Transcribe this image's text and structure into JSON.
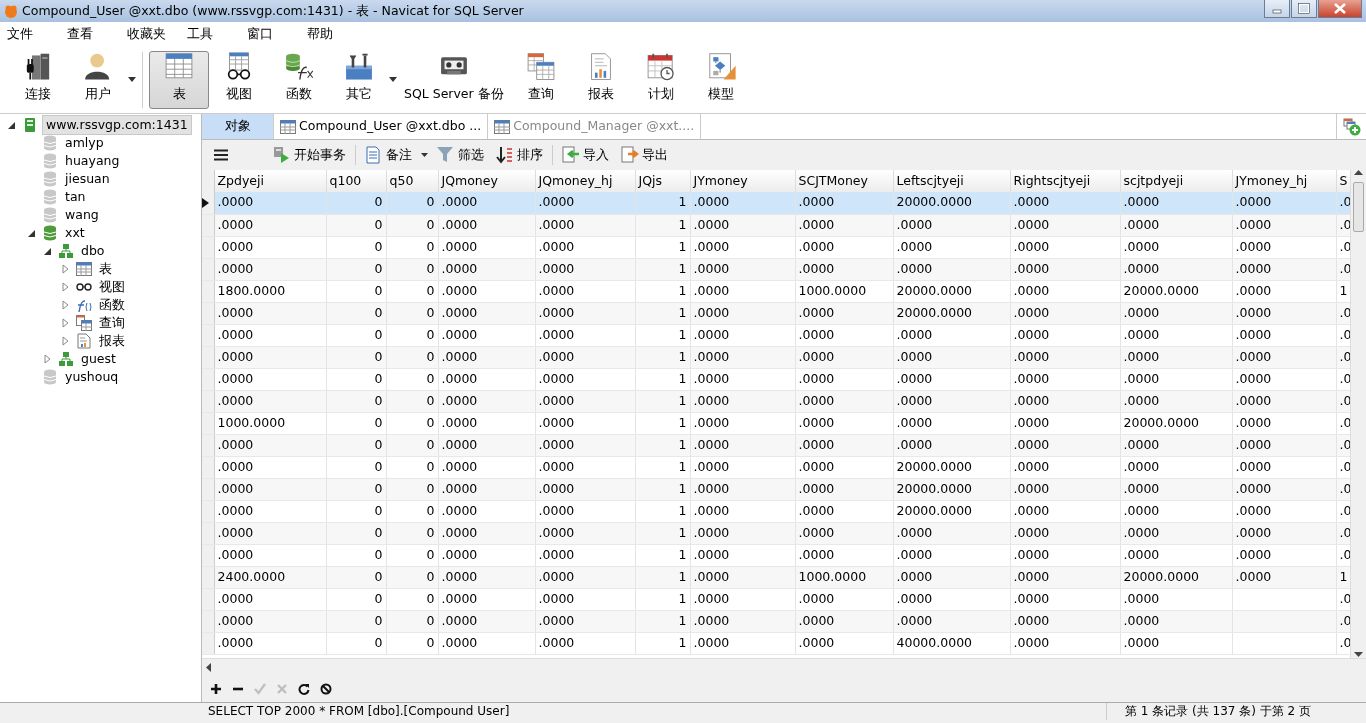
{
  "window": {
    "title": "Compound_User @xxt.dbo (www.rssvgp.com:1431) - 表 - Navicat for SQL Server"
  },
  "menu": [
    "文件",
    "查看",
    "收藏夹",
    "工具",
    "窗口",
    "帮助"
  ],
  "toolbar": [
    {
      "label": "连接",
      "selected": false,
      "dropdown": false
    },
    {
      "label": "用户",
      "selected": false,
      "dropdown": true
    },
    {
      "label": "表",
      "selected": true,
      "dropdown": false
    },
    {
      "label": "视图",
      "selected": false,
      "dropdown": false
    },
    {
      "label": "函数",
      "selected": false,
      "dropdown": false
    },
    {
      "label": "其它",
      "selected": false,
      "dropdown": true
    },
    {
      "label": "SQL Server 备份",
      "selected": false,
      "dropdown": false
    },
    {
      "label": "查询",
      "selected": false,
      "dropdown": false
    },
    {
      "label": "报表",
      "selected": false,
      "dropdown": false
    },
    {
      "label": "计划",
      "selected": false,
      "dropdown": false
    },
    {
      "label": "模型",
      "selected": false,
      "dropdown": false
    }
  ],
  "tree": [
    {
      "label": "www.rssvgp.com:1431",
      "kind": "server",
      "expanded": true,
      "selected": true,
      "children": [
        {
          "label": "amlyp",
          "kind": "database",
          "expanded": false,
          "selected": false
        },
        {
          "label": "huayang",
          "kind": "database",
          "expanded": false,
          "selected": false
        },
        {
          "label": "jiesuan",
          "kind": "database",
          "expanded": false,
          "selected": false
        },
        {
          "label": "tan",
          "kind": "database",
          "expanded": false,
          "selected": false
        },
        {
          "label": "wang",
          "kind": "database",
          "expanded": false,
          "selected": false
        },
        {
          "label": "xxt",
          "kind": "database",
          "expanded": true,
          "selected": false,
          "children": [
            {
              "label": "dbo",
              "kind": "schema",
              "expanded": true,
              "selected": false,
              "children": [
                {
                  "label": "表",
                  "kind": "table",
                  "expanded": false,
                  "selected": false
                },
                {
                  "label": "视图",
                  "kind": "view",
                  "expanded": false,
                  "selected": false
                },
                {
                  "label": "函数",
                  "kind": "function",
                  "expanded": false,
                  "selected": false
                },
                {
                  "label": "查询",
                  "kind": "query",
                  "expanded": false,
                  "selected": false
                },
                {
                  "label": "报表",
                  "kind": "report",
                  "expanded": false,
                  "selected": false
                }
              ]
            },
            {
              "label": "guest",
              "kind": "schema",
              "expanded": false,
              "selected": false
            }
          ]
        },
        {
          "label": "yushouq",
          "kind": "database",
          "expanded": false,
          "selected": false
        }
      ]
    }
  ],
  "tabs": [
    {
      "label": "对象",
      "kind": "objects",
      "selected": false
    },
    {
      "label": "Compound_User @xxt.dbo ...",
      "kind": "table",
      "selected": true
    },
    {
      "label": "Compound_Manager @xxt....",
      "kind": "table",
      "selected": false
    }
  ],
  "table_toolbar": [
    {
      "label": "开始事务",
      "dropdown": false
    },
    {
      "label": "备注",
      "dropdown": true
    },
    {
      "label": "筛选",
      "dropdown": false
    },
    {
      "label": "排序",
      "dropdown": false
    },
    {
      "label": "导入",
      "dropdown": false
    },
    {
      "label": "导出",
      "dropdown": false
    }
  ],
  "table": {
    "columns": [
      {
        "label": "Zpdyeji"
      },
      {
        "label": "q100"
      },
      {
        "label": "q50"
      },
      {
        "label": "JQmoney"
      },
      {
        "label": "JQmoney_hj"
      },
      {
        "label": "JQjs"
      },
      {
        "label": "JYmoney"
      },
      {
        "label": "SCJTMoney"
      },
      {
        "label": "Leftscjtyeji"
      },
      {
        "label": "Rightscjtyeji"
      },
      {
        "label": "scjtpdyeji"
      },
      {
        "label": "JYmoney_hj"
      },
      {
        "label": "S"
      }
    ],
    "rows": [
      {
        "selected": true,
        "cells": [
          ".0000",
          "0",
          "0",
          ".0000",
          ".0000",
          "1",
          ".0000",
          ".0000",
          "20000.0000",
          ".0000",
          ".0000",
          ".0000",
          ".0"
        ]
      },
      {
        "selected": false,
        "cells": [
          ".0000",
          "0",
          "0",
          ".0000",
          ".0000",
          "1",
          ".0000",
          ".0000",
          ".0000",
          ".0000",
          ".0000",
          ".0000",
          ".0"
        ]
      },
      {
        "selected": false,
        "cells": [
          ".0000",
          "0",
          "0",
          ".0000",
          ".0000",
          "1",
          ".0000",
          ".0000",
          ".0000",
          ".0000",
          ".0000",
          ".0000",
          ".0"
        ]
      },
      {
        "selected": false,
        "cells": [
          ".0000",
          "0",
          "0",
          ".0000",
          ".0000",
          "1",
          ".0000",
          ".0000",
          ".0000",
          ".0000",
          ".0000",
          ".0000",
          ".0"
        ]
      },
      {
        "selected": false,
        "cells": [
          "1800.0000",
          "0",
          "0",
          ".0000",
          ".0000",
          "1",
          ".0000",
          "1000.0000",
          "20000.0000",
          ".0000",
          "20000.0000",
          ".0000",
          "1"
        ]
      },
      {
        "selected": false,
        "cells": [
          ".0000",
          "0",
          "0",
          ".0000",
          ".0000",
          "1",
          ".0000",
          ".0000",
          "20000.0000",
          ".0000",
          ".0000",
          ".0000",
          ".0"
        ]
      },
      {
        "selected": false,
        "cells": [
          ".0000",
          "0",
          "0",
          ".0000",
          ".0000",
          "1",
          ".0000",
          ".0000",
          ".0000",
          ".0000",
          ".0000",
          ".0000",
          ".0"
        ]
      },
      {
        "selected": false,
        "cells": [
          ".0000",
          "0",
          "0",
          ".0000",
          ".0000",
          "1",
          ".0000",
          ".0000",
          ".0000",
          ".0000",
          ".0000",
          ".0000",
          ".0"
        ]
      },
      {
        "selected": false,
        "cells": [
          ".0000",
          "0",
          "0",
          ".0000",
          ".0000",
          "1",
          ".0000",
          ".0000",
          ".0000",
          ".0000",
          ".0000",
          ".0000",
          ".0"
        ]
      },
      {
        "selected": false,
        "cells": [
          ".0000",
          "0",
          "0",
          ".0000",
          ".0000",
          "1",
          ".0000",
          ".0000",
          ".0000",
          ".0000",
          ".0000",
          ".0000",
          ".0"
        ]
      },
      {
        "selected": false,
        "cells": [
          "1000.0000",
          "0",
          "0",
          ".0000",
          ".0000",
          "1",
          ".0000",
          ".0000",
          ".0000",
          ".0000",
          "20000.0000",
          ".0000",
          ".0"
        ]
      },
      {
        "selected": false,
        "cells": [
          ".0000",
          "0",
          "0",
          ".0000",
          ".0000",
          "1",
          ".0000",
          ".0000",
          ".0000",
          ".0000",
          ".0000",
          ".0000",
          ".0"
        ]
      },
      {
        "selected": false,
        "cells": [
          ".0000",
          "0",
          "0",
          ".0000",
          ".0000",
          "1",
          ".0000",
          ".0000",
          "20000.0000",
          ".0000",
          ".0000",
          ".0000",
          ".0"
        ]
      },
      {
        "selected": false,
        "cells": [
          ".0000",
          "0",
          "0",
          ".0000",
          ".0000",
          "1",
          ".0000",
          ".0000",
          "20000.0000",
          ".0000",
          ".0000",
          ".0000",
          ".0"
        ]
      },
      {
        "selected": false,
        "cells": [
          ".0000",
          "0",
          "0",
          ".0000",
          ".0000",
          "1",
          ".0000",
          ".0000",
          "20000.0000",
          ".0000",
          ".0000",
          ".0000",
          ".0"
        ]
      },
      {
        "selected": false,
        "cells": [
          ".0000",
          "0",
          "0",
          ".0000",
          ".0000",
          "1",
          ".0000",
          ".0000",
          ".0000",
          ".0000",
          ".0000",
          ".0000",
          ".0"
        ]
      },
      {
        "selected": false,
        "cells": [
          ".0000",
          "0",
          "0",
          ".0000",
          ".0000",
          "1",
          ".0000",
          ".0000",
          ".0000",
          ".0000",
          ".0000",
          ".0000",
          ".0"
        ]
      },
      {
        "selected": false,
        "cells": [
          "2400.0000",
          "0",
          "0",
          ".0000",
          ".0000",
          "1",
          ".0000",
          "1000.0000",
          ".0000",
          ".0000",
          "20000.0000",
          ".0000",
          "1"
        ]
      },
      {
        "selected": false,
        "cells": [
          ".0000",
          "0",
          "0",
          ".0000",
          ".0000",
          "1",
          ".0000",
          ".0000",
          ".0000",
          ".0000",
          ".0000",
          null,
          ".0"
        ]
      },
      {
        "selected": false,
        "cells": [
          ".0000",
          "0",
          "0",
          ".0000",
          ".0000",
          "1",
          ".0000",
          ".0000",
          ".0000",
          ".0000",
          ".0000",
          null,
          ".0"
        ]
      },
      {
        "selected": false,
        "cells": [
          ".0000",
          "0",
          "0",
          ".0000",
          ".0000",
          "1",
          ".0000",
          ".0000",
          "40000.0000",
          ".0000",
          ".0000",
          null,
          ".0"
        ]
      }
    ]
  },
  "record_buttons": [
    {
      "disabled": false
    },
    {
      "disabled": false
    },
    {
      "disabled": true
    },
    {
      "disabled": true
    },
    {
      "disabled": false
    },
    {
      "disabled": false
    }
  ],
  "status_bar": {
    "query": "SELECT TOP 2000  * FROM [dbo].[Compound User]",
    "record_info": "第 1 条记录 (共 137 条) 于第 2 页"
  }
}
